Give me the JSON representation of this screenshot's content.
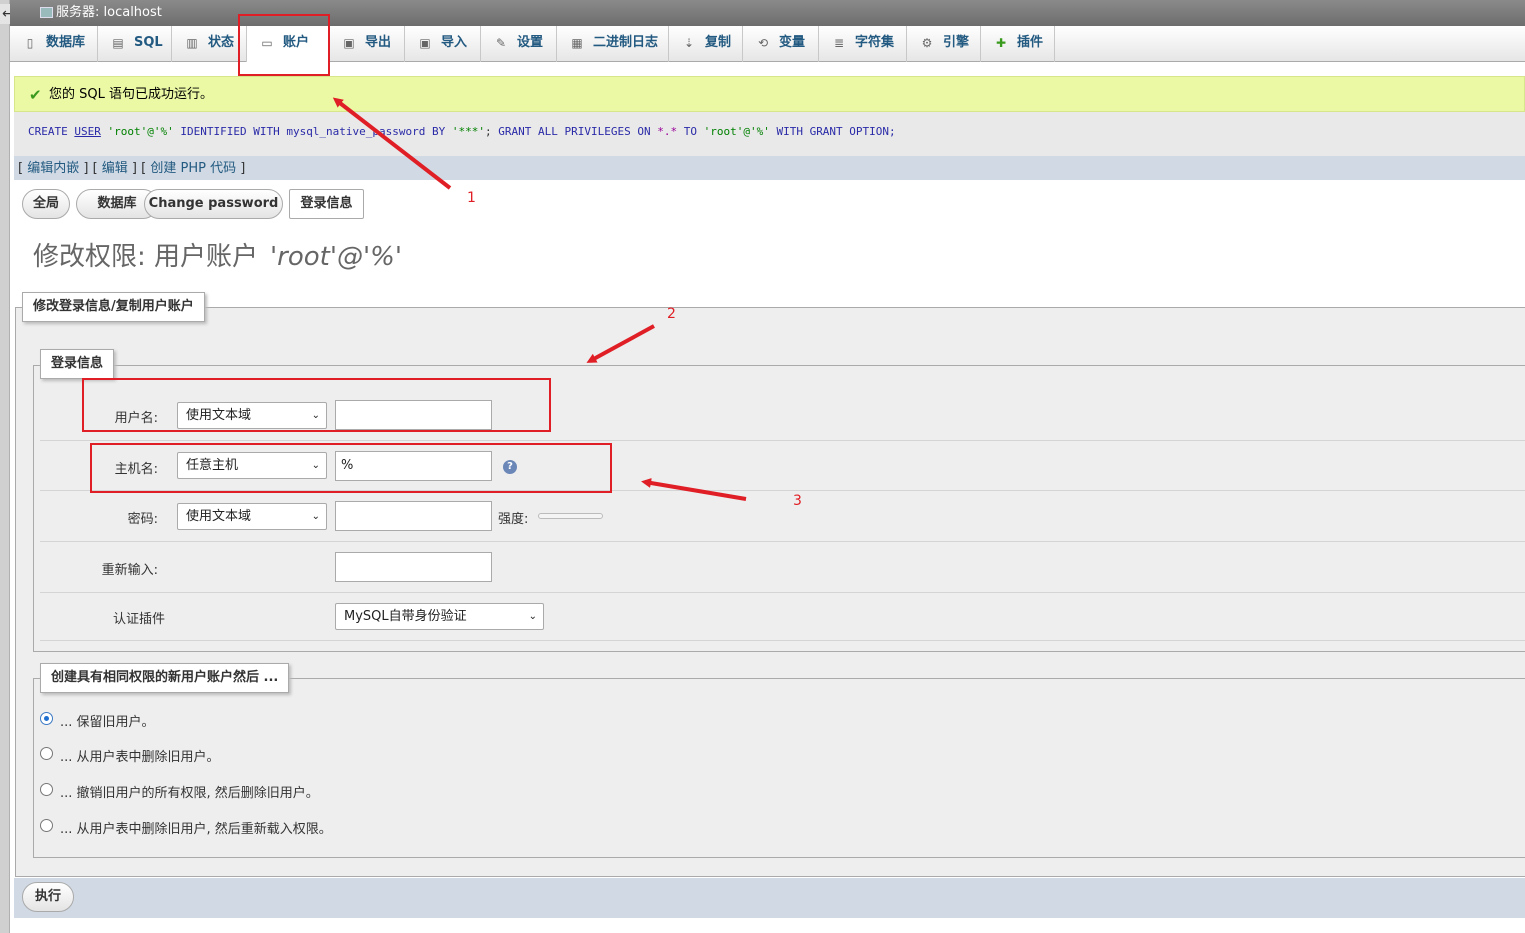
{
  "topbar": {
    "server_label": "服务器: localhost",
    "back_arrow": "←"
  },
  "tabs": [
    {
      "label": "数据库",
      "icon": "database-icon"
    },
    {
      "label": "SQL",
      "icon": "sql-icon"
    },
    {
      "label": "状态",
      "icon": "status-icon"
    },
    {
      "label": "账户",
      "icon": "accounts-icon",
      "active": true
    },
    {
      "label": "导出",
      "icon": "export-icon"
    },
    {
      "label": "导入",
      "icon": "import-icon"
    },
    {
      "label": "设置",
      "icon": "settings-icon"
    },
    {
      "label": "二进制日志",
      "icon": "binlog-icon"
    },
    {
      "label": "复制",
      "icon": "replication-icon"
    },
    {
      "label": "变量",
      "icon": "variables-icon"
    },
    {
      "label": "字符集",
      "icon": "charset-icon"
    },
    {
      "label": "引擎",
      "icon": "engine-icon"
    },
    {
      "label": "插件",
      "icon": "plugin-icon"
    }
  ],
  "message": {
    "success": "您的 SQL 语句已成功运行。"
  },
  "sql": {
    "p1": "CREATE",
    "p2": "USER",
    "p3": "'root'@'%'",
    "p4": "IDENTIFIED WITH mysql_native_password BY",
    "p5": "'***'",
    "p6": ";",
    "p7": "GRANT ALL PRIVILEGES ON",
    "p8": "*.*",
    "p9": "TO",
    "p10": "'root'@'%'",
    "p11": "WITH GRANT OPTION;"
  },
  "query_links": {
    "inline_edit": "编辑内嵌",
    "edit": "编辑",
    "create_php": "创建 PHP 代码"
  },
  "subtabs": {
    "global": "全局",
    "database": "数据库",
    "change_password": "Change password",
    "login_info": "登录信息"
  },
  "page": {
    "title_prefix": "修改权限:  用户账户",
    "account": "'root'@'%'"
  },
  "legends": {
    "outer": "修改登录信息/复制用户账户",
    "login": "登录信息",
    "create_new": "创建具有相同权限的新用户账户然后 ..."
  },
  "form": {
    "username_label": "用户名:",
    "username_type": "使用文本域",
    "username_value": "",
    "hostname_label": "主机名:",
    "hostname_type": "任意主机",
    "hostname_value": "%",
    "password_label": "密码:",
    "password_type": "使用文本域",
    "password_value": "",
    "strength_label": "强度:",
    "retype_label": "重新输入:",
    "retype_value": "",
    "auth_plugin_label": "认证插件",
    "auth_plugin_value": "MySQL自带身份验证"
  },
  "options": [
    {
      "label": "... 保留旧用户。",
      "selected": true
    },
    {
      "label": "... 从用户表中删除旧用户。",
      "selected": false
    },
    {
      "label": "... 撤销旧用户的所有权限, 然后删除旧用户。",
      "selected": false
    },
    {
      "label": "... 从用户表中删除旧用户, 然后重新载入权限。",
      "selected": false
    }
  ],
  "submit": {
    "label": "执行"
  },
  "annotations": {
    "n1": "1",
    "n2": "2",
    "n3": "3",
    "color": "#e01e25"
  }
}
